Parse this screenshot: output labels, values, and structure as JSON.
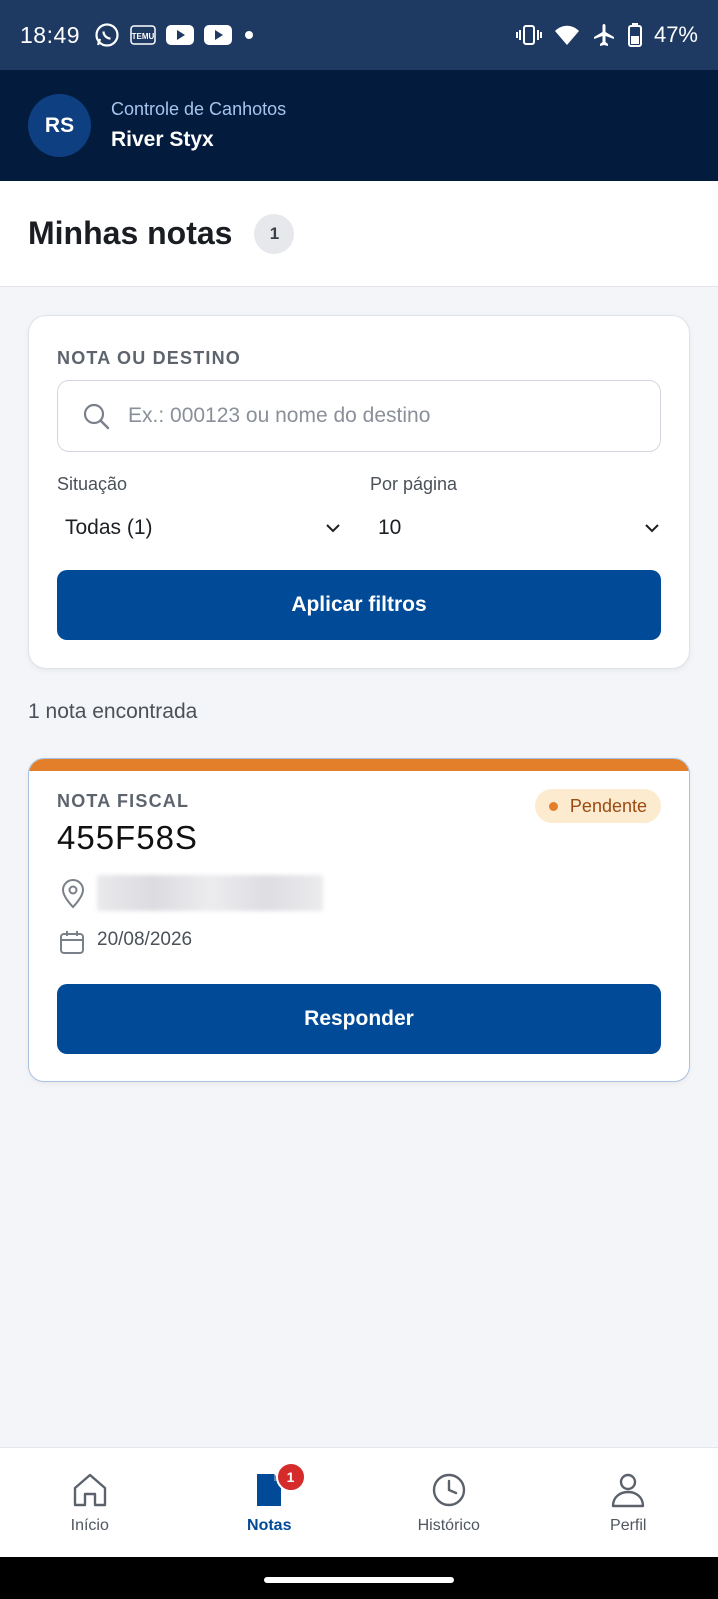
{
  "status_bar": {
    "time": "18:49",
    "battery": "47%",
    "left_icons": [
      "whatsapp-icon",
      "temu-icon",
      "youtube-icon",
      "youtube-icon",
      "dot-icon"
    ],
    "right_icons": [
      "vibrate-icon",
      "wifi-icon",
      "airplane-icon",
      "battery-icon"
    ]
  },
  "header": {
    "avatar_initials": "RS",
    "app_title": "Controle de Canhotos",
    "user_name": "River Styx"
  },
  "page": {
    "title": "Minhas notas",
    "count": "1"
  },
  "filters": {
    "search_label": "NOTA OU DESTINO",
    "search_placeholder": "Ex.: 000123 ou nome do destino",
    "search_value": "",
    "status_label": "Situação",
    "status_value": "Todas (1)",
    "per_page_label": "Por página",
    "per_page_value": "10",
    "apply_label": "Aplicar filtros"
  },
  "results_text": "1 nota encontrada",
  "notes": [
    {
      "type_label": "NOTA FISCAL",
      "number": "455F58S",
      "status": "Pendente",
      "date": "20/08/2026",
      "action_label": "Responder"
    }
  ],
  "bottom_nav": [
    {
      "label": "Início",
      "icon": "home-icon"
    },
    {
      "label": "Notas",
      "icon": "document-icon",
      "badge": "1"
    },
    {
      "label": "Histórico",
      "icon": "clock-icon"
    },
    {
      "label": "Perfil",
      "icon": "person-icon"
    }
  ],
  "colors": {
    "primary": "#004a97",
    "header_bg": "#031b3d",
    "status_bar_bg": "#1e3a63",
    "pending_accent": "#e37f2b",
    "badge_red": "#d52b2b"
  }
}
